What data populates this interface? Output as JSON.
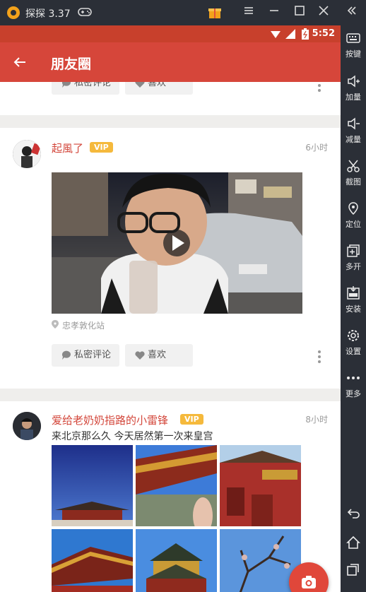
{
  "emulator": {
    "app_name": "探探 3.37",
    "sidebar": [
      {
        "label": "按键",
        "icon": "keyboard-icon"
      },
      {
        "label": "加量",
        "icon": "volume-up-icon"
      },
      {
        "label": "减量",
        "icon": "volume-down-icon"
      },
      {
        "label": "截图",
        "icon": "scissors-icon"
      },
      {
        "label": "定位",
        "icon": "location-pin-icon"
      },
      {
        "label": "多开",
        "icon": "multi-instance-icon"
      },
      {
        "label": "安装",
        "icon": "apk-install-icon"
      },
      {
        "label": "设置",
        "icon": "gear-icon"
      },
      {
        "label": "更多",
        "icon": "more-dots-icon"
      }
    ]
  },
  "statusbar": {
    "time": "5:52"
  },
  "appbar": {
    "title": "朋友圈"
  },
  "posts": [
    {
      "user": "起風了",
      "vip": "VIP",
      "time": "6小时",
      "location": "忠孝敦化站",
      "comment_label": "私密评论",
      "like_label": "喜欢"
    },
    {
      "user": "爱给老奶奶指路的小雷锋",
      "vip": "VIP",
      "time": "8小时",
      "text": "来北京那么久 今天居然第一次来皇宫"
    }
  ],
  "partial_post": {
    "comment_label": "私密评论",
    "like_label": "喜欢"
  },
  "colors": {
    "accent": "#d6463a",
    "vip": "#f5b93c",
    "emulator_bg": "#2b2f37"
  }
}
